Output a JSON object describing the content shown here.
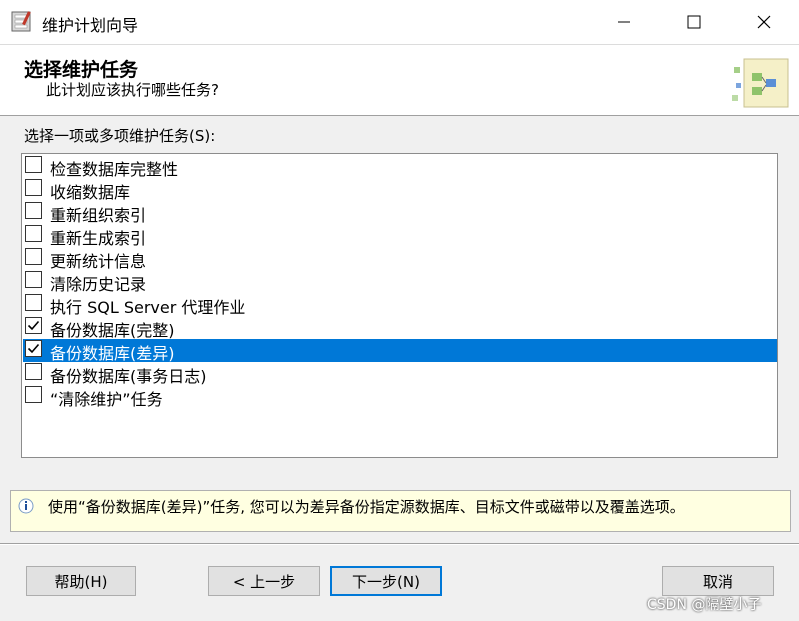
{
  "window": {
    "title": "维护计划向导",
    "minimize_glyph": "—",
    "close_glyph": "✕"
  },
  "header": {
    "title": "选择维护任务",
    "subtitle": "此计划应该执行哪些任务?"
  },
  "task_section": {
    "label": "选择一项或多项维护任务(S):",
    "items": [
      {
        "label": "检查数据库完整性",
        "checked": false,
        "selected": false
      },
      {
        "label": "收缩数据库",
        "checked": false,
        "selected": false
      },
      {
        "label": "重新组织索引",
        "checked": false,
        "selected": false
      },
      {
        "label": "重新生成索引",
        "checked": false,
        "selected": false
      },
      {
        "label": "更新统计信息",
        "checked": false,
        "selected": false
      },
      {
        "label": "清除历史记录",
        "checked": false,
        "selected": false
      },
      {
        "label": "执行 SQL Server 代理作业",
        "checked": false,
        "selected": false
      },
      {
        "label": "备份数据库(完整)",
        "checked": true,
        "selected": false
      },
      {
        "label": "备份数据库(差异)",
        "checked": true,
        "selected": true
      },
      {
        "label": "备份数据库(事务日志)",
        "checked": false,
        "selected": false
      },
      {
        "label": "“清除维护”任务",
        "checked": false,
        "selected": false
      }
    ]
  },
  "info": {
    "text": "使用“备份数据库(差异)”任务, 您可以为差异备份指定源数据库、目标文件或磁带以及覆盖选项。"
  },
  "buttons": {
    "help": "帮助(H)",
    "prev": "< 上一步",
    "next": "下一步(N)",
    "cancel": "取消"
  },
  "watermark": "CSDN @隔壁小子",
  "colors": {
    "selection": "#0078d7",
    "info_background": "#ffffe1",
    "dialog_background": "#f0f0f0"
  }
}
